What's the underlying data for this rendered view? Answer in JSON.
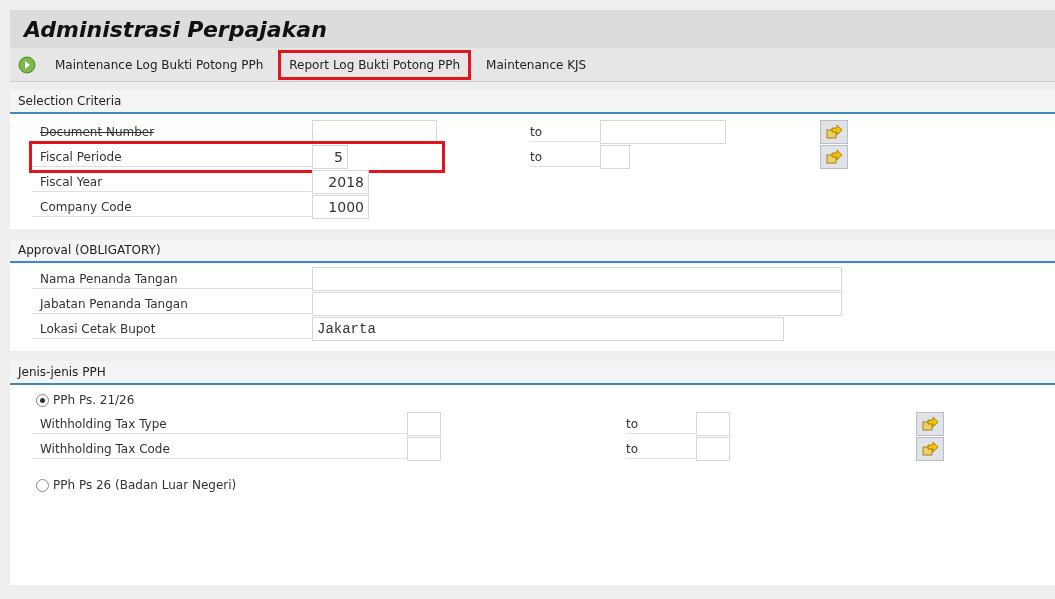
{
  "title": "Administrasi Perpajakan",
  "toolbar": [
    {
      "label": "Maintenance Log Bukti Potong PPh",
      "kind": "execute",
      "highlighted": false
    },
    {
      "label": "Report Log Bukti Potong PPh",
      "kind": "plain",
      "highlighted": true
    },
    {
      "label": "Maintenance KJS",
      "kind": "plain",
      "highlighted": false
    }
  ],
  "selection": {
    "title": "Selection Criteria",
    "rows": [
      {
        "label": "Document Number",
        "struck": true,
        "highlighted": false,
        "value": "",
        "to_label": "to",
        "to_value": ""
      },
      {
        "label": "Fiscal Periode",
        "struck": false,
        "highlighted": true,
        "value": "5",
        "to_label": "to",
        "to_value": ""
      },
      {
        "label": "Fiscal Year",
        "struck": false,
        "highlighted": false,
        "value": "2018"
      },
      {
        "label": "Company Code",
        "struck": false,
        "highlighted": false,
        "value": "1000"
      }
    ]
  },
  "approval": {
    "title": "Approval (OBLIGATORY)",
    "rows": [
      {
        "label": "Nama Penanda Tangan",
        "value": ""
      },
      {
        "label": "Jabatan Penanda Tangan",
        "value": ""
      },
      {
        "label": "Lokasi Cetak Bupot",
        "value": "Jakarta"
      }
    ]
  },
  "jenis": {
    "title": "Jenis-jenis PPH",
    "options": [
      {
        "label": "PPh Ps. 21/26",
        "selected": true,
        "rows": [
          {
            "label": "Withholding Tax Type",
            "value": "",
            "to_label": "to",
            "to_value": ""
          },
          {
            "label": "Withholding Tax Code",
            "value": "",
            "to_label": "to",
            "to_value": ""
          }
        ]
      },
      {
        "label": "PPh Ps 26 (Badan Luar Negeri)",
        "selected": false
      }
    ]
  }
}
